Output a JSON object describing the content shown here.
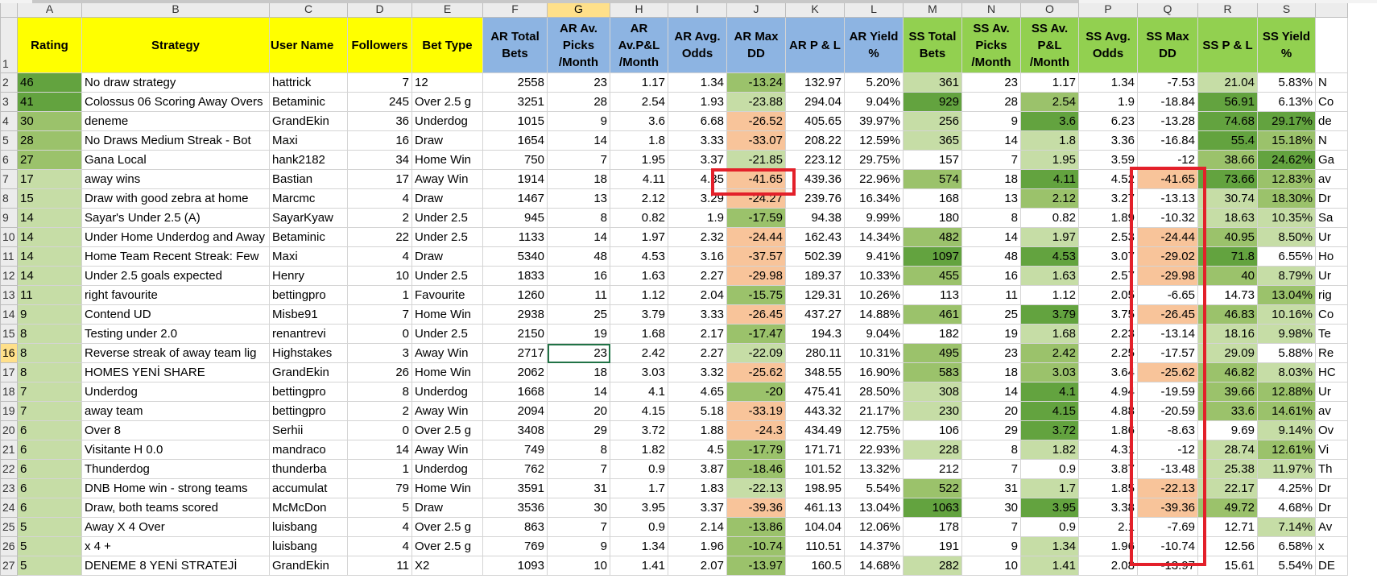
{
  "columns": [
    "A",
    "B",
    "C",
    "D",
    "E",
    "F",
    "G",
    "H",
    "I",
    "J",
    "K",
    "L",
    "M",
    "N",
    "O",
    "P",
    "Q",
    "R",
    "S"
  ],
  "active_column": "G",
  "active_row": "16",
  "headers": [
    "Rating",
    "Strategy",
    "User Name",
    "Followers",
    "Bet Type",
    "AR Total Bets",
    "AR Av. Picks /Month",
    "AR Av.P&L /Month",
    "AR Avg. Odds",
    "AR Max DD",
    "AR P & L",
    "AR Yield %",
    "SS Total Bets",
    "SS Av. Picks /Month",
    "SS Av. P&L /Month",
    "SS Avg. Odds",
    "SS Max DD",
    "SS P & L",
    "SS Yield %"
  ],
  "rows": [
    {
      "n": "2",
      "c": [
        "46",
        "No draw strategy",
        "hattrick",
        "7",
        "12",
        "2558",
        "23",
        "1.17",
        "1.34",
        "-13.24",
        "132.97",
        "5.20%",
        "361",
        "23",
        "1.17",
        "1.34",
        "-7.53",
        "21.04",
        "5.83%",
        "N"
      ]
    },
    {
      "n": "3",
      "c": [
        "41",
        "Colossus 06 Scoring Away Overs",
        "Betaminic",
        "245",
        "Over 2.5 g",
        "3251",
        "28",
        "2.54",
        "1.93",
        "-23.88",
        "294.04",
        "9.04%",
        "929",
        "28",
        "2.54",
        "1.9",
        "-18.84",
        "56.91",
        "6.13%",
        "Co"
      ]
    },
    {
      "n": "4",
      "c": [
        "30",
        "deneme",
        "GrandEkin",
        "36",
        "Underdog",
        "1015",
        "9",
        "3.6",
        "6.68",
        "-26.52",
        "405.65",
        "39.97%",
        "256",
        "9",
        "3.6",
        "6.23",
        "-13.28",
        "74.68",
        "29.17%",
        "de"
      ]
    },
    {
      "n": "5",
      "c": [
        "28",
        "No Draws Medium Streak - Bot",
        "Maxi",
        "16",
        "Draw",
        "1654",
        "14",
        "1.8",
        "3.33",
        "-33.07",
        "208.22",
        "12.59%",
        "365",
        "14",
        "1.8",
        "3.36",
        "-16.84",
        "55.4",
        "15.18%",
        "N"
      ]
    },
    {
      "n": "6",
      "c": [
        "27",
        "Gana Local",
        "hank2182",
        "34",
        "Home Win",
        "750",
        "7",
        "1.95",
        "3.37",
        "-21.85",
        "223.12",
        "29.75%",
        "157",
        "7",
        "1.95",
        "3.59",
        "-12",
        "38.66",
        "24.62%",
        "Ga"
      ]
    },
    {
      "n": "7",
      "c": [
        "17",
        "away wins",
        "Bastian",
        "17",
        "Away Win",
        "1914",
        "18",
        "4.11",
        "4.35",
        "-41.65",
        "439.36",
        "22.96%",
        "574",
        "18",
        "4.11",
        "4.52",
        "-41.65",
        "73.66",
        "12.83%",
        "av"
      ]
    },
    {
      "n": "8",
      "c": [
        "15",
        "Draw with good zebra at home",
        "Marcmc",
        "4",
        "Draw",
        "1467",
        "13",
        "2.12",
        "3.29",
        "-24.27",
        "239.76",
        "16.34%",
        "168",
        "13",
        "2.12",
        "3.27",
        "-13.13",
        "30.74",
        "18.30%",
        "Dr"
      ]
    },
    {
      "n": "9",
      "c": [
        "14",
        "Sayar's Under 2.5 (A)",
        "SayarKyaw",
        "2",
        "Under 2.5",
        "945",
        "8",
        "0.82",
        "1.9",
        "-17.59",
        "94.38",
        "9.99%",
        "180",
        "8",
        "0.82",
        "1.89",
        "-10.32",
        "18.63",
        "10.35%",
        "Sa"
      ]
    },
    {
      "n": "10",
      "c": [
        "14",
        "Under Home Underdog and Away",
        "Betaminic",
        "22",
        "Under 2.5",
        "1133",
        "14",
        "1.97",
        "2.32",
        "-24.44",
        "162.43",
        "14.34%",
        "482",
        "14",
        "1.97",
        "2.53",
        "-24.44",
        "40.95",
        "8.50%",
        "Ur"
      ]
    },
    {
      "n": "11",
      "c": [
        "14",
        "Home Team Recent Streak: Few",
        "Maxi",
        "4",
        "Draw",
        "5340",
        "48",
        "4.53",
        "3.16",
        "-37.57",
        "502.39",
        "9.41%",
        "1097",
        "48",
        "4.53",
        "3.07",
        "-29.02",
        "71.8",
        "6.55%",
        "Ho"
      ]
    },
    {
      "n": "12",
      "c": [
        "14",
        "Under 2.5 goals expected",
        "Henry",
        "10",
        "Under 2.5",
        "1833",
        "16",
        "1.63",
        "2.27",
        "-29.98",
        "189.37",
        "10.33%",
        "455",
        "16",
        "1.63",
        "2.57",
        "-29.98",
        "40",
        "8.79%",
        "Ur"
      ]
    },
    {
      "n": "13",
      "c": [
        "11",
        "right favourite",
        "bettingpro",
        "1",
        "Favourite",
        "1260",
        "11",
        "1.12",
        "2.04",
        "-15.75",
        "129.31",
        "10.26%",
        "113",
        "11",
        "1.12",
        "2.05",
        "-6.65",
        "14.73",
        "13.04%",
        "rig"
      ]
    },
    {
      "n": "14",
      "c": [
        "9",
        "Contend UD",
        "Misbe91",
        "7",
        "Home Win",
        "2938",
        "25",
        "3.79",
        "3.33",
        "-26.45",
        "437.27",
        "14.88%",
        "461",
        "25",
        "3.79",
        "3.75",
        "-26.45",
        "46.83",
        "10.16%",
        "Co"
      ]
    },
    {
      "n": "15",
      "c": [
        "8",
        "Testing under 2.0",
        "renantrevi",
        "0",
        "Under 2.5",
        "2150",
        "19",
        "1.68",
        "2.17",
        "-17.47",
        "194.3",
        "9.04%",
        "182",
        "19",
        "1.68",
        "2.23",
        "-13.14",
        "18.16",
        "9.98%",
        "Te"
      ]
    },
    {
      "n": "16",
      "c": [
        "8",
        "Reverse streak of away team lig",
        "Highstakes",
        "3",
        "Away Win",
        "2717",
        "23",
        "2.42",
        "2.27",
        "-22.09",
        "280.11",
        "10.31%",
        "495",
        "23",
        "2.42",
        "2.25",
        "-17.57",
        "29.09",
        "5.88%",
        "Re"
      ]
    },
    {
      "n": "17",
      "c": [
        "8",
        "HOMES YENİ SHARE",
        "GrandEkin",
        "26",
        "Home Win",
        "2062",
        "18",
        "3.03",
        "3.32",
        "-25.62",
        "348.55",
        "16.90%",
        "583",
        "18",
        "3.03",
        "3.64",
        "-25.62",
        "46.82",
        "8.03%",
        "HC"
      ]
    },
    {
      "n": "18",
      "c": [
        "7",
        "Underdog",
        "bettingpro",
        "8",
        "Underdog",
        "1668",
        "14",
        "4.1",
        "4.65",
        "-20",
        "475.41",
        "28.50%",
        "308",
        "14",
        "4.1",
        "4.94",
        "-19.59",
        "39.66",
        "12.88%",
        "Ur"
      ]
    },
    {
      "n": "19",
      "c": [
        "7",
        "away team",
        "bettingpro",
        "2",
        "Away Win",
        "2094",
        "20",
        "4.15",
        "5.18",
        "-33.19",
        "443.32",
        "21.17%",
        "230",
        "20",
        "4.15",
        "4.88",
        "-20.59",
        "33.6",
        "14.61%",
        "av"
      ]
    },
    {
      "n": "20",
      "c": [
        "6",
        "Over 8",
        "Serhii",
        "0",
        "Over 2.5 g",
        "3408",
        "29",
        "3.72",
        "1.88",
        "-24.3",
        "434.49",
        "12.75%",
        "106",
        "29",
        "3.72",
        "1.86",
        "-8.63",
        "9.69",
        "9.14%",
        "Ov"
      ]
    },
    {
      "n": "21",
      "c": [
        "6",
        "Visitante H 0.0",
        "mandraco",
        "14",
        "Away Win",
        "749",
        "8",
        "1.82",
        "4.5",
        "-17.79",
        "171.71",
        "22.93%",
        "228",
        "8",
        "1.82",
        "4.31",
        "-12",
        "28.74",
        "12.61%",
        "Vi"
      ]
    },
    {
      "n": "22",
      "c": [
        "6",
        "Thunderdog",
        "thunderba",
        "1",
        "Underdog",
        "762",
        "7",
        "0.9",
        "3.87",
        "-18.46",
        "101.52",
        "13.32%",
        "212",
        "7",
        "0.9",
        "3.87",
        "-13.48",
        "25.38",
        "11.97%",
        "Th"
      ]
    },
    {
      "n": "23",
      "c": [
        "6",
        "DNB Home win - strong teams",
        "accumulat",
        "79",
        "Home Win",
        "3591",
        "31",
        "1.7",
        "1.83",
        "-22.13",
        "198.95",
        "5.54%",
        "522",
        "31",
        "1.7",
        "1.85",
        "-22.13",
        "22.17",
        "4.25%",
        "Dr"
      ]
    },
    {
      "n": "24",
      "c": [
        "6",
        "Draw, both teams scored",
        "McMcDon",
        "5",
        "Draw",
        "3536",
        "30",
        "3.95",
        "3.37",
        "-39.36",
        "461.13",
        "13.04%",
        "1063",
        "30",
        "3.95",
        "3.38",
        "-39.36",
        "49.72",
        "4.68%",
        "Dr"
      ]
    },
    {
      "n": "25",
      "c": [
        "5",
        "Away X 4 Over",
        "luisbang",
        "4",
        "Over 2.5 g",
        "863",
        "7",
        "0.9",
        "2.14",
        "-13.86",
        "104.04",
        "12.06%",
        "178",
        "7",
        "0.9",
        "2.1",
        "-7.69",
        "12.71",
        "7.14%",
        "Av"
      ]
    },
    {
      "n": "26",
      "c": [
        "5",
        "x 4 +",
        "luisbang",
        "4",
        "Over 2.5 g",
        "769",
        "9",
        "1.34",
        "1.96",
        "-10.74",
        "110.51",
        "14.37%",
        "191",
        "9",
        "1.34",
        "1.96",
        "-10.74",
        "12.56",
        "6.58%",
        "x"
      ]
    },
    {
      "n": "27",
      "c": [
        "5",
        "DENEME 8 YENİ STRATEJİ",
        "GrandEkin",
        "11",
        "X2",
        "1093",
        "10",
        "1.41",
        "2.07",
        "-13.97",
        "160.5",
        "14.68%",
        "282",
        "10",
        "1.41",
        "2.08",
        "-13.97",
        "15.61",
        "5.54%",
        "DE"
      ]
    }
  ],
  "colors": {
    "header_yellow": "#ffff00",
    "header_blue": "#8db4e2",
    "header_green": "#92d050",
    "annotation_red": "#e3202a",
    "scale_dark_green": "#63a33f",
    "scale_mid_green": "#9bc26b",
    "scale_light_green": "#c6dda6",
    "scale_orange": "#f8c49a"
  }
}
